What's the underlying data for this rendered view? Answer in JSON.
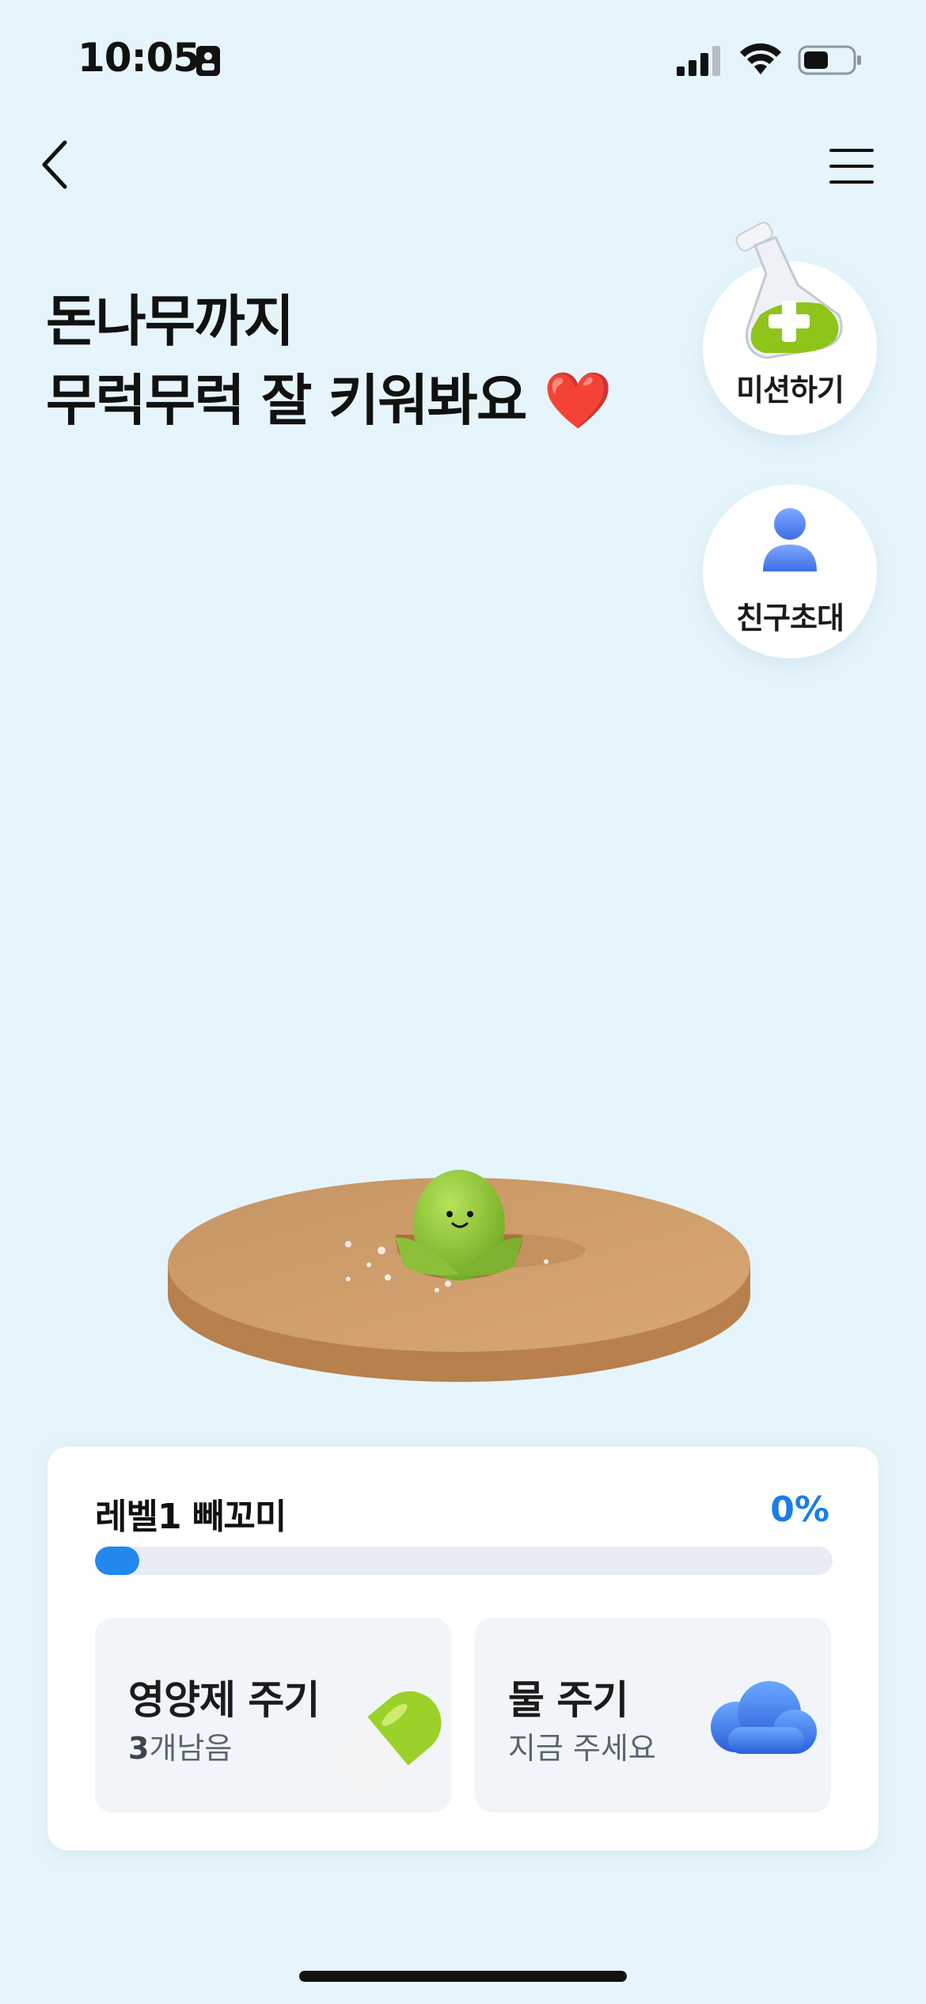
{
  "status_bar": {
    "time": "10:05"
  },
  "header": {
    "title_line1": "돈나무까지",
    "title_line2": "무럭무럭 잘 키워봐요",
    "emoji": "❤️"
  },
  "side_buttons": [
    {
      "label": "미션하기",
      "icon": "flask-icon"
    },
    {
      "label": "친구초대",
      "icon": "person-icon"
    }
  ],
  "progress": {
    "level_label": "레벨1 빼꼬미",
    "percent_text": "0%",
    "fill_fraction": 0.06,
    "accent": "#1a7de8"
  },
  "actions": {
    "nutrient": {
      "title": "영양제 주기",
      "count": "3",
      "count_suffix": "개남음",
      "icon": "pill-icon"
    },
    "water": {
      "title": "물 주기",
      "subtitle": "지금 주세요",
      "icon": "cloud-icon"
    }
  },
  "colors": {
    "background": "#e6f5fc",
    "card": "#ffffff",
    "accent": "#1a7de8"
  }
}
